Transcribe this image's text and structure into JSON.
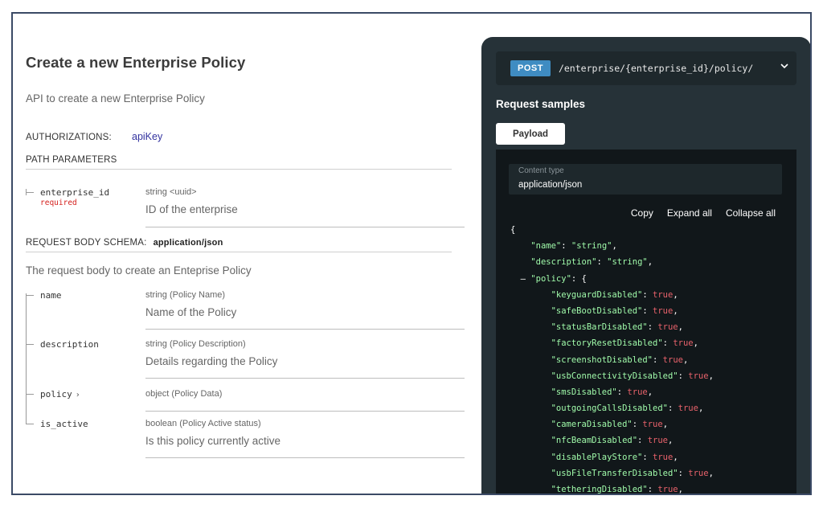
{
  "docs": {
    "title": "Create a new Enterprise Policy",
    "description": "API to create a new Enterprise Policy",
    "authorizations_label": "AUTHORIZATIONS:",
    "authorizations_value": "apiKey",
    "path_params_label": "PATH PARAMETERS",
    "path_params": [
      {
        "name": "enterprise_id",
        "required": "required",
        "type": "string <uuid>",
        "description": "ID of the enterprise"
      }
    ],
    "body_schema_label": "REQUEST BODY SCHEMA:",
    "body_schema_type": "application/json",
    "body_description": "The request body to create an Enteprise Policy",
    "body_params": [
      {
        "name": "name",
        "type": "string (Policy Name)",
        "description": "Name of the Policy"
      },
      {
        "name": "description",
        "type": "string (Policy Description)",
        "description": "Details regarding the Policy"
      },
      {
        "name": "policy",
        "expand_icon": "chevron-right-icon",
        "type": "object (Policy Data)",
        "description": ""
      },
      {
        "name": "is_active",
        "type": "boolean (Policy Active status)",
        "description": "Is this policy currently active"
      }
    ]
  },
  "sample": {
    "method": "POST",
    "path": "/enterprise/{enterprise_id}/policy/",
    "title": "Request samples",
    "tab": "Payload",
    "content_type_label": "Content type",
    "content_type": "application/json",
    "actions": {
      "copy": "Copy",
      "expand": "Expand all",
      "collapse": "Collapse all"
    },
    "code": {
      "open": "{",
      "name_key": "\"name\"",
      "name_val": "\"string\"",
      "desc_key": "\"description\"",
      "desc_val": "\"string\"",
      "policy_marker": "–",
      "policy_key": "\"policy\"",
      "policy_open": "{",
      "flags": [
        {
          "key": "\"keyguardDisabled\"",
          "val": "true"
        },
        {
          "key": "\"safeBootDisabled\"",
          "val": "true"
        },
        {
          "key": "\"statusBarDisabled\"",
          "val": "true"
        },
        {
          "key": "\"factoryResetDisabled\"",
          "val": "true"
        },
        {
          "key": "\"screenshotDisabled\"",
          "val": "true"
        },
        {
          "key": "\"usbConnectivityDisabled\"",
          "val": "true"
        },
        {
          "key": "\"smsDisabled\"",
          "val": "true"
        },
        {
          "key": "\"outgoingCallsDisabled\"",
          "val": "true"
        },
        {
          "key": "\"cameraDisabled\"",
          "val": "true"
        },
        {
          "key": "\"nfcBeamDisabled\"",
          "val": "true"
        },
        {
          "key": "\"disablePlayStore\"",
          "val": "true"
        },
        {
          "key": "\"usbFileTransferDisabled\"",
          "val": "true"
        },
        {
          "key": "\"tetheringDisabled\"",
          "val": "true"
        }
      ]
    }
  },
  "colors": {
    "panel_bg": "#263238",
    "code_bg": "#11171a",
    "method_badge": "#3f8cc2",
    "json_key": "#a0fbaa",
    "json_bool": "#e9626b",
    "required": "#d41f1c",
    "link": "#32329f"
  }
}
